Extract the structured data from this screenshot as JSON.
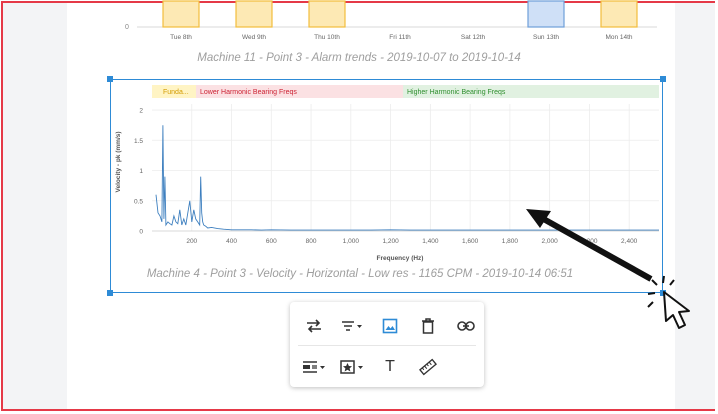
{
  "alarm_chart": {
    "y_tick": "0",
    "days": [
      "Tue 8th",
      "Wed 9th",
      "Thu 10th",
      "Fri 11th",
      "Sat 12th",
      "Sun 13th",
      "Mon 14th"
    ],
    "bars": [
      {
        "day": "Tue 8th",
        "status": "warning"
      },
      {
        "day": "Wed 9th",
        "status": "warning"
      },
      {
        "day": "Thu 10th",
        "status": "warning"
      },
      {
        "day": "Sun 13th",
        "status": "ok"
      },
      {
        "day": "Mon 14th",
        "status": "warning"
      }
    ],
    "caption": "Machine 11 - Point 3 - Alarm trends - 2019-10-07 to 2019-10-14"
  },
  "spectrum": {
    "bands": {
      "fundamental": "Funda...",
      "lower": "Lower Harmonic Bearing Freqs",
      "higher": "Higher Harmonic Bearing Freqs"
    },
    "caption": "Machine 4 - Point 3 - Velocity - Horizontal - Low res - 1165 CPM - 2019-10-14 06:51"
  },
  "chart_data": {
    "type": "line",
    "title": "",
    "xlabel": "Frequency (Hz)",
    "ylabel": "Velocity - pk (mm/s)",
    "x_ticks": [
      "200",
      "400",
      "600",
      "800",
      "1,000",
      "1,200",
      "1,400",
      "1,600",
      "1,800",
      "2,000",
      "2,200",
      "2,400"
    ],
    "y_ticks": [
      "0",
      "0.5",
      "1",
      "1.5",
      "2"
    ],
    "xlim": [
      0,
      2550
    ],
    "ylim": [
      0,
      2.1
    ],
    "grid": true,
    "series": [
      {
        "x": [
          20,
          30,
          40,
          50,
          55,
          60,
          65,
          70,
          80,
          90,
          100,
          110,
          120,
          130,
          140,
          150,
          160,
          170,
          180,
          190,
          200,
          210,
          220,
          230,
          240,
          245,
          250,
          255,
          260,
          270,
          280,
          300,
          330,
          360,
          400,
          450,
          500,
          550,
          600,
          700,
          800,
          900,
          1000,
          1100,
          1200,
          1300,
          1400,
          1500,
          1600,
          1700,
          1800,
          1900,
          2000,
          2100,
          2200,
          2300,
          2400,
          2500,
          2550
        ],
        "y": [
          0.6,
          0.3,
          0.25,
          0.15,
          1.75,
          0.2,
          0.9,
          0.1,
          0.15,
          0.12,
          0.1,
          0.25,
          0.15,
          0.12,
          0.35,
          0.1,
          0.2,
          0.1,
          0.3,
          0.5,
          0.15,
          0.35,
          0.2,
          0.15,
          0.1,
          0.9,
          0.3,
          0.15,
          0.1,
          0.08,
          0.05,
          0.06,
          0.04,
          0.03,
          0.02,
          0.02,
          0.02,
          0.015,
          0.02,
          0.015,
          0.015,
          0.015,
          0.015,
          0.015,
          0.02,
          0.015,
          0.015,
          0.015,
          0.015,
          0.015,
          0.015,
          0.015,
          0.015,
          0.015,
          0.015,
          0.015,
          0.015,
          0.015,
          0.015
        ],
        "color": "#3d7fbf"
      }
    ]
  },
  "toolbar": {
    "row1": [
      "swap-icon",
      "filter-dropdown-icon",
      "image-icon",
      "delete-icon",
      "link-icon"
    ],
    "row2": [
      "align-dropdown-icon",
      "badge-dropdown-icon",
      "text-icon",
      "ruler-icon"
    ],
    "text_glyph": "T"
  },
  "colors": {
    "accent": "#2e8bd6",
    "frame": "#e53947",
    "warning_fill": "#fde9b4",
    "warning_border": "#f2bd3c",
    "ok_fill": "#cfe0f7",
    "ok_border": "#6f9fd9",
    "band_fund": "#fff4c4",
    "band_lower": "#fbe1e3",
    "band_higher": "#e1f1e1"
  }
}
